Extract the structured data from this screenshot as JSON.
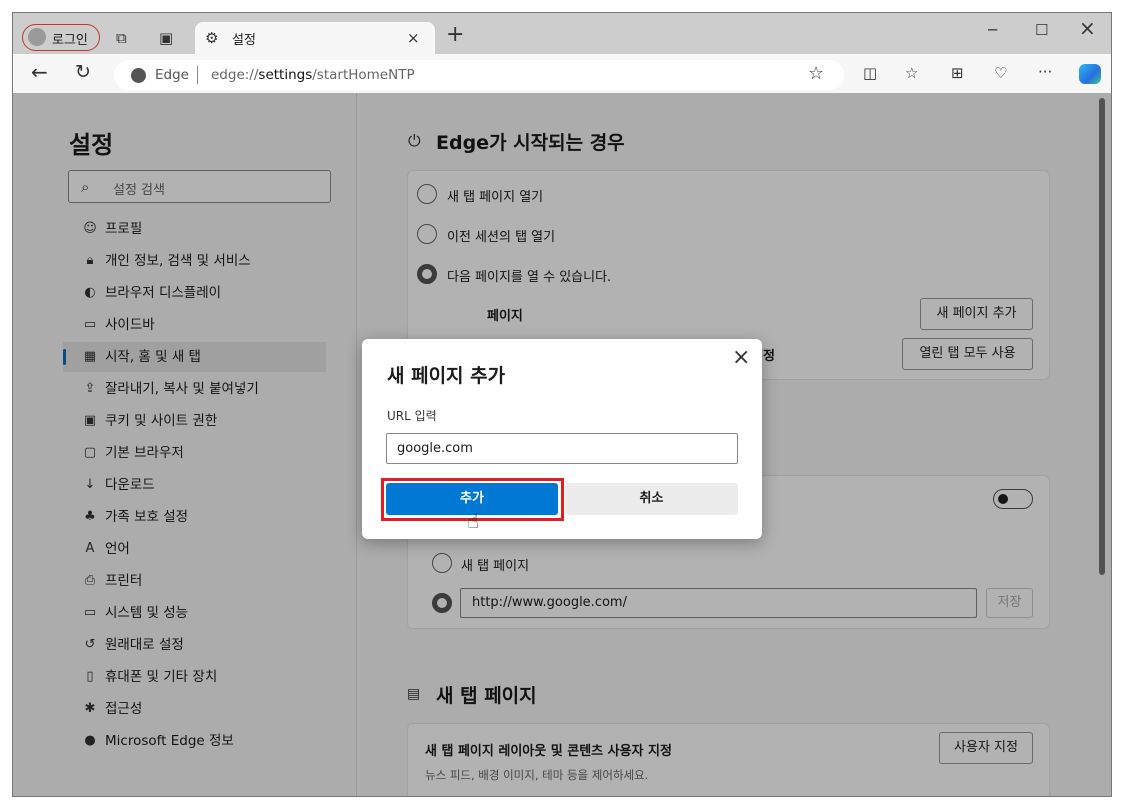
{
  "browser": {
    "profile_label": "로그인",
    "tab_title": "설정",
    "address_prefix": "Edge",
    "url_scheme": "edge://",
    "url_host": "settings",
    "url_path": "/startHomeNTP"
  },
  "sidebar": {
    "title": "설정",
    "search_placeholder": "설정 검색",
    "active_index": 4,
    "items": [
      {
        "label": "프로필",
        "icon": "profile-icon"
      },
      {
        "label": "개인 정보, 검색 및 서비스",
        "icon": "lock-icon"
      },
      {
        "label": "브라우저 디스플레이",
        "icon": "palette-icon"
      },
      {
        "label": "사이드바",
        "icon": "sidebar-icon"
      },
      {
        "label": "시작, 홈 및 새 탭",
        "icon": "start-home-icon"
      },
      {
        "label": "잘라내기, 복사 및 붙여넣기",
        "icon": "share-icon"
      },
      {
        "label": "쿠키 및 사이트 권한",
        "icon": "cookie-icon"
      },
      {
        "label": "기본 브라우저",
        "icon": "browser-icon"
      },
      {
        "label": "다운로드",
        "icon": "download-icon"
      },
      {
        "label": "가족 보호 설정",
        "icon": "family-icon"
      },
      {
        "label": "언어",
        "icon": "language-icon"
      },
      {
        "label": "프린터",
        "icon": "printer-icon"
      },
      {
        "label": "시스템 및 성능",
        "icon": "laptop-icon"
      },
      {
        "label": "원래대로 설정",
        "icon": "reset-icon"
      },
      {
        "label": "휴대폰 및 기타 장치",
        "icon": "phone-icon"
      },
      {
        "label": "접근성",
        "icon": "accessibility-icon"
      },
      {
        "label": "Microsoft Edge 정보",
        "icon": "edge-icon"
      }
    ]
  },
  "main": {
    "startup": {
      "heading": "Edge가 시작되는 경우",
      "options": [
        "새 탭 페이지 열기",
        "이전 세션의 탭 열기",
        "다음 페이지를 열 수 있습니다."
      ],
      "selected": 2,
      "pages_label": "페이지",
      "add_page_button": "새 페이지 추가",
      "partial_label": "정",
      "use_all_tabs_button": "열린 탭 모두 사용"
    },
    "home": {
      "toggle_on": false,
      "options": [
        "새 탭 페이지"
      ],
      "url_value": "http://www.google.com/",
      "save_button": "저장"
    },
    "new_tab": {
      "heading": "새 탭 페이지",
      "item_title": "새 탭 페이지 레이아웃 및 콘텐츠 사용자 지정",
      "item_desc": "뉴스 피드, 배경 이미지, 테마 등을 제어하세요.",
      "customize_button": "사용자 지정"
    }
  },
  "dialog": {
    "title": "새 페이지 추가",
    "url_label": "URL 입력",
    "url_value": "google.com",
    "add_button": "추가",
    "cancel_button": "취소",
    "accent": "#0078d4",
    "highlight": "#e02020"
  }
}
